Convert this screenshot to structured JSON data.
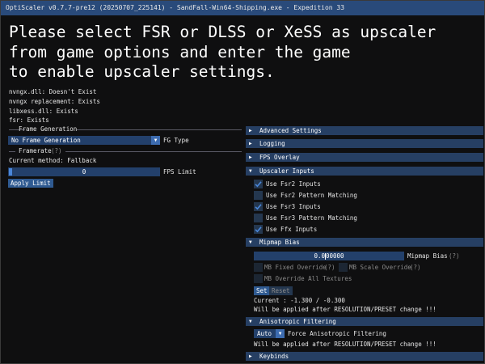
{
  "window": {
    "title": "OptiScaler v0.7.7-pre12 (20250707_225141) - SandFall-Win64-Shipping.exe - Expedition 33"
  },
  "headline": {
    "line1": "Please select FSR or DLSS or XeSS as upscaler",
    "line2": "from game options and enter the game",
    "line3": "to enable upscaler settings."
  },
  "status": {
    "nvngx": "nvngx.dll: Doesn't Exist",
    "replacement": "nvngx replacement: Exists",
    "libxess": "libxess.dll: Exists",
    "fsr": "fsr: Exists"
  },
  "left": {
    "frame_generation": {
      "title": "Frame Generation",
      "fg_type_value": "No Frame Generation",
      "fg_type_label": "FG Type"
    },
    "framerate": {
      "title": "Framerate",
      "help": "(?)",
      "method": "Current method: Fallback",
      "fps_value": "0",
      "fps_label": "FPS Limit",
      "apply_label": "Apply Limit"
    }
  },
  "right": {
    "advanced_settings": "Advanced Settings",
    "logging": "Logging",
    "fps_overlay": "FPS Overlay",
    "upscaler_inputs": {
      "title": "Upscaler Inputs",
      "items": [
        {
          "label": "Use Fsr2 Inputs",
          "checked": true
        },
        {
          "label": "Use Fsr2 Pattern Matching",
          "checked": false
        },
        {
          "label": "Use Fsr3 Inputs",
          "checked": true
        },
        {
          "label": "Use Fsr3 Pattern Matching",
          "checked": false
        },
        {
          "label": "Use Ffx Inputs",
          "checked": true
        }
      ]
    },
    "mipmap_bias": {
      "title": "Mipmap Bias",
      "value_left": "0.0",
      "value_right": "00000",
      "label": "Mipmap Bias",
      "help": "(?)",
      "fixed_override": "MB Fixed Override",
      "scale_override": "MB Scale Override",
      "override_all": "MB Override All Textures",
      "set_label": "Set",
      "reset_label": "Reset",
      "current": "Current : -1.300 / -0.300",
      "note": "Will be applied after RESOLUTION/PRESET change !!!"
    },
    "anisotropic": {
      "title": "Anisotropic Filtering",
      "value": "Auto",
      "label": "Force Anisotropic Filtering",
      "note": "Will be applied after RESOLUTION/PRESET change !!!"
    },
    "keybinds": "Keybinds"
  },
  "icons": {
    "expanded": "triangle-down-icon",
    "collapsed": "triangle-right-icon",
    "check": "checkmark-icon"
  },
  "colors": {
    "title_bar": "#294a7a",
    "header": "#263f63",
    "frame": "#23406b",
    "button": "#2f5a91",
    "check": "#4a86d8"
  }
}
